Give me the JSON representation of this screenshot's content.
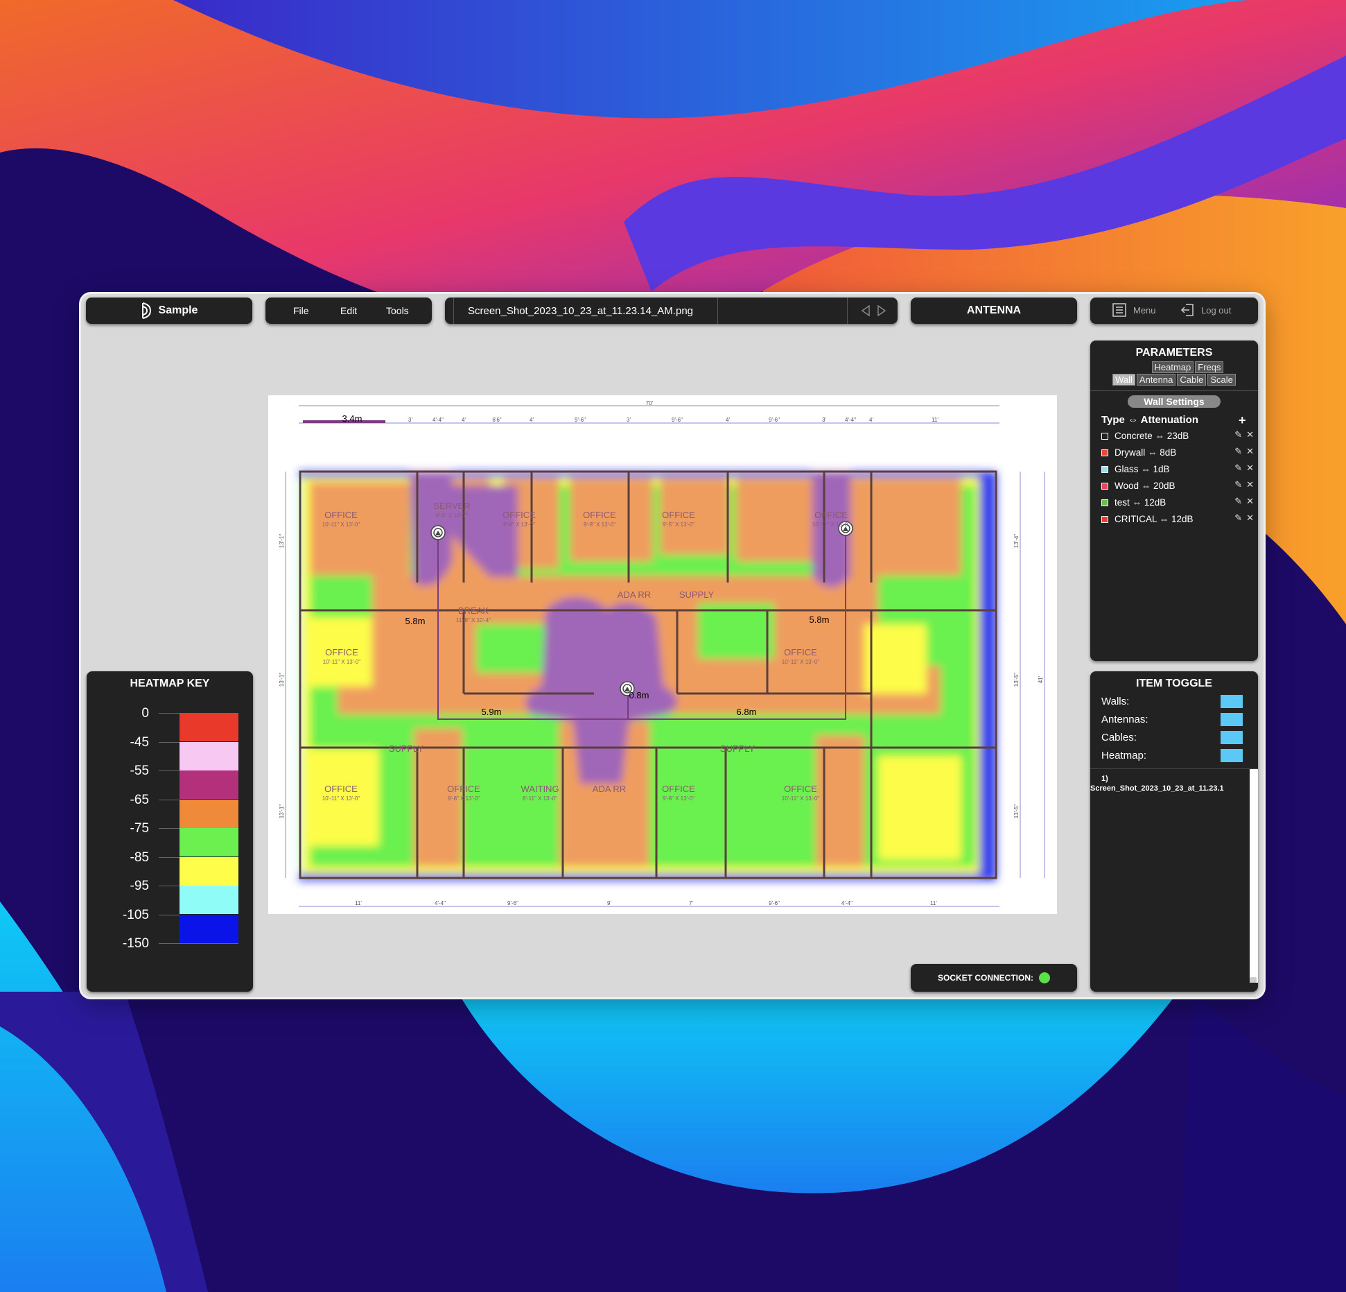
{
  "app": {
    "name": "Sample"
  },
  "menubar": {
    "items": [
      "File",
      "Edit",
      "Tools"
    ]
  },
  "file_tab": {
    "filename": "Screen_Shot_2023_10_23_at_11.23.14_AM.png"
  },
  "mode": {
    "label": "ANTENNA"
  },
  "account": {
    "menu_label": "Menu",
    "logout_label": "Log out"
  },
  "parameters": {
    "title": "PARAMETERS",
    "tabs_row1": [
      "Heatmap",
      "Freqs"
    ],
    "tabs_row2": [
      "Wall",
      "Antenna",
      "Cable",
      "Scale"
    ],
    "active_tab": "Wall",
    "section_title": "Wall Settings",
    "list_header": "Type ⇔ Attenuation",
    "add_symbol": "+",
    "walls": [
      {
        "label": "Concrete ⇔ 23dB",
        "color": "#ffffff"
      },
      {
        "label": "Drywall ⇔ 8dB",
        "color": "#e8483a"
      },
      {
        "label": "Glass ⇔ 1dB",
        "color": "#8de3f0"
      },
      {
        "label": "Wood ⇔ 20dB",
        "color": "#f0435a"
      },
      {
        "label": "test ⇔ 12dB",
        "color": "#6cc04a"
      },
      {
        "label": "CRITICAL ⇔ 12dB",
        "color": "#ef3a3a"
      }
    ]
  },
  "item_toggle": {
    "title": "ITEM TOGGLE",
    "items": [
      "Walls:",
      "Antennas:",
      "Cables:",
      "Heatmap:"
    ],
    "toggle_color": "#5cc8f5",
    "file_list": [
      "1)",
      "Screen_Shot_2023_10_23_at_11.23.1"
    ]
  },
  "heatmap_key": {
    "title": "HEATMAP KEY",
    "levels": [
      {
        "label": "0",
        "color": "#e8392a"
      },
      {
        "label": "-45",
        "color": "#f6c8f2"
      },
      {
        "label": "-55",
        "color": "#b3317a"
      },
      {
        "label": "-65",
        "color": "#ef8a3a"
      },
      {
        "label": "-75",
        "color": "#6bf04f"
      },
      {
        "label": "-85",
        "color": "#fdfd4a"
      },
      {
        "label": "-95",
        "color": "#8ffcf8"
      },
      {
        "label": "-105",
        "color": "#0a14e8"
      },
      {
        "label": "-150",
        "color": ""
      }
    ]
  },
  "socket": {
    "label": "SOCKET CONNECTION:",
    "status_color": "#5ce04a"
  },
  "floorplan": {
    "rooms": [
      {
        "name": "OFFICE",
        "dims": "10'-11\" X 13'-0\""
      },
      {
        "name": "SERVER",
        "dims": "6'-5\" X 10'-7\""
      },
      {
        "name": "OFFICE",
        "dims": "9'-8\" X 13'-0\""
      },
      {
        "name": "OFFICE",
        "dims": "9'-8\" X 13'-0\""
      },
      {
        "name": "OFFICE",
        "dims": "9'-5\" X 13'-0\""
      },
      {
        "name": "OFFICE",
        "dims": "10'-11\" X 13'-0\""
      },
      {
        "name": "OFFICE",
        "dims": "10'-11\" X 13'-0\""
      },
      {
        "name": "BREAK",
        "dims": "11'-8\" X 10'-4\""
      },
      {
        "name": "ADA RR",
        "dims": ""
      },
      {
        "name": "SUPPLY",
        "dims": ""
      },
      {
        "name": "OFFICE",
        "dims": "10'-11\" X 13'-0\""
      },
      {
        "name": "SUPPLY",
        "dims": ""
      },
      {
        "name": "OFFICE",
        "dims": "10'-11\" X 13'-0\""
      },
      {
        "name": "SUPPLY",
        "dims": ""
      },
      {
        "name": "OFFICE",
        "dims": "9'-8\" X 13'-0\""
      },
      {
        "name": "WAITING",
        "dims": "8'-11\" X 13'-0\""
      },
      {
        "name": "ADA RR",
        "dims": ""
      },
      {
        "name": "OFFICE",
        "dims": "9'-8\" X 13'-0\""
      },
      {
        "name": "SUPPLY",
        "dims": ""
      },
      {
        "name": "OFFICE",
        "dims": "10'-11\" X 13'-0\""
      }
    ],
    "cable_labels": [
      "3.4m",
      "5.8m",
      "5.8m",
      "5.9m",
      "0.8m",
      "6.8m"
    ],
    "top_dims": [
      "70'",
      "3'",
      "4'-4\"",
      "4'",
      "6'6\"",
      "4'",
      "9'-6\"",
      "3'",
      "9'-6\"",
      "4'",
      "9'-6\"",
      "3'",
      "4'-4\"",
      "4'",
      "11'"
    ],
    "bottom_dims": [
      "11'",
      "4'-4\"",
      "9'-6\"",
      "9'",
      "7'",
      "9'-6\"",
      "4'-4\"",
      "11'"
    ],
    "side_dims": [
      "13'-1\"",
      "13'-1\"",
      "13'-1\"",
      "13'-4\"",
      "13'-5\"",
      "41'",
      "13'-5\""
    ]
  }
}
